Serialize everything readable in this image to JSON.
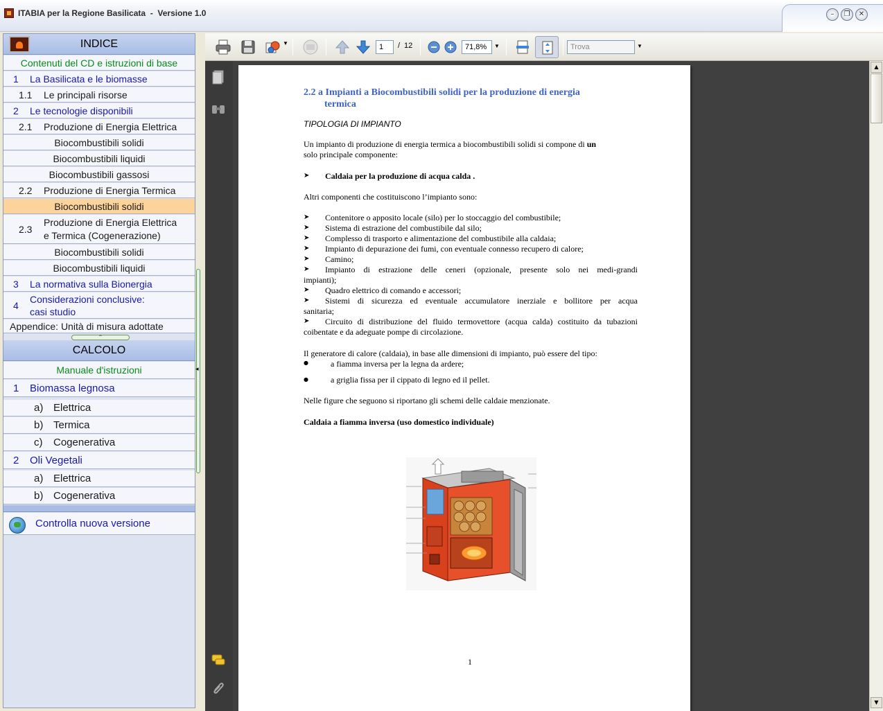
{
  "window": {
    "title": "ITABIA per la Regione Basilicata  -  Versione 1.0"
  },
  "index": {
    "header": "INDICE",
    "items": [
      {
        "num": "",
        "label": "Contenuti del CD e istruzioni di base"
      },
      {
        "num": "1",
        "label": "La Basilicata e le biomasse"
      },
      {
        "num": "1.1",
        "label": "Le principali risorse"
      },
      {
        "num": "2",
        "label": "Le tecnologie disponibili"
      },
      {
        "num": "2.1",
        "label": "Produzione di Energia Elettrica"
      },
      {
        "num": "",
        "label": "Biocombustibili solidi"
      },
      {
        "num": "",
        "label": "Biocombustibili liquidi"
      },
      {
        "num": "",
        "label": "Biocombustibili gassosi"
      },
      {
        "num": "2.2",
        "label": "Produzione di Energia Termica"
      },
      {
        "num": "",
        "label": "Biocombustibili solidi"
      },
      {
        "num": "2.3",
        "label": "Produzione di Energia Elettrica",
        "label2": "e Termica (Cogenerazione)"
      },
      {
        "num": "",
        "label": "Biocombustibili solidi"
      },
      {
        "num": "",
        "label": "Biocombustibili liquidi"
      },
      {
        "num": "3",
        "label": "La normativa sulla Bionergia"
      },
      {
        "num": "4",
        "label": "Considerazioni conclusive:",
        "label2": "casi studio"
      },
      {
        "num": "",
        "label": "Appendice: Unità di misura adottate"
      }
    ]
  },
  "calcolo": {
    "header": "CALCOLO",
    "items": [
      {
        "num": "",
        "label": "Manuale d'istruzioni"
      },
      {
        "num": "1",
        "label": "Biomassa legnosa"
      },
      {
        "num": "a)",
        "label": "Elettrica"
      },
      {
        "num": "b)",
        "label": "Termica"
      },
      {
        "num": "c)",
        "label": "Cogenerativa"
      },
      {
        "num": "2",
        "label": "Oli Vegetali"
      },
      {
        "num": "a)",
        "label": "Elettrica"
      },
      {
        "num": "b)",
        "label": "Cogenerativa"
      }
    ],
    "check_update": "Controlla nuova versione"
  },
  "toolbar": {
    "page_current": "1",
    "page_sep": "/",
    "page_total": "12",
    "zoom": "71,8%",
    "search_placeholder": "Trova"
  },
  "document": {
    "heading1": "2.2 a Impianti a Biocombustibili solidi per la produzione di energia",
    "heading2": "termica",
    "subtitle": "TIPOLOGIA DI IMPIANTO",
    "intro1": "Un impianto di produzione di energia termica a biocombustibili solidi si compone di",
    "intro1_bold": "un",
    "intro2": "solo principale componente:",
    "main_component": "Caldaia per la produzione di acqua calda .",
    "others_intro": "Altri componenti che costituiscono l’impianto sono:",
    "components": [
      "Contenitore o apposito locale (silo) per lo stoccaggio del combustibile;",
      "Sistema di estrazione del combustibile dal silo;",
      "Complesso di trasporto e alimentazione del combustibile alla caldaia;",
      "Impianto di depurazione dei fumi, con eventuale connesso recupero di calore;",
      "Camino;",
      "Impianto di estrazione delle ceneri (opzionale, presente solo nei medi-grandi",
      "Quadro elettrico di comando e accessori;",
      "Sistemi di sicurezza ed eventuale accumulatore inerziale e bollitore per acqua",
      "Circuito di distribuzione del fluido termovettore (acqua calda) costituito da tubazioni"
    ],
    "continuations": {
      "impianti": "impianti);",
      "sanitaria": "sanitaria;",
      "coibentate": "coibentate e da adeguate pompe di circolazione."
    },
    "generator_intro": "Il generatore di calore (caldaia), in base alle dimensioni di impianto, può essere del tipo:",
    "types": [
      "a fiamma inversa per la legna da ardere;",
      "a griglia fissa per il cippato di legno ed il pellet."
    ],
    "figures_note": "Nelle figure che seguono si riportano gli schemi delle caldaie menzionate.",
    "caption": "Caldaia a fiamma inversa (uso domestico individuale)",
    "page_number": "1"
  },
  "colors": {
    "heading_blue": "#3d63c7",
    "selected_row": "#fbd39b",
    "green_text": "#0a8a1a",
    "nav_blue": "#1818b0"
  }
}
